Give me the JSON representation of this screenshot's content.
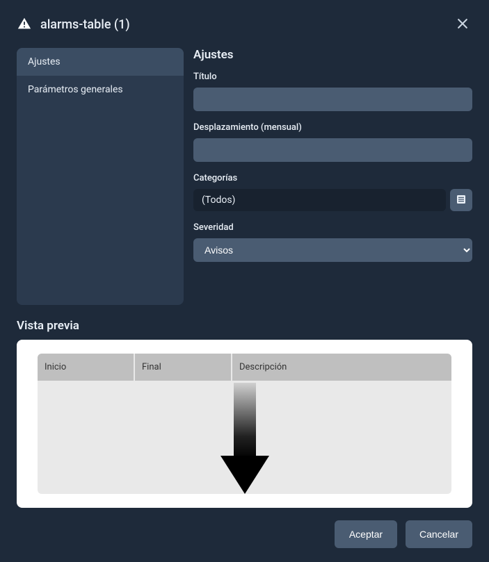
{
  "header": {
    "title": "alarms-table (1)"
  },
  "sidebar": {
    "items": [
      {
        "label": "Ajustes",
        "active": true
      },
      {
        "label": "Parámetros generales",
        "active": false
      }
    ]
  },
  "panel": {
    "title": "Ajustes",
    "titulo_label": "Título",
    "titulo_value": "",
    "desplazamiento_label": "Desplazamiento (mensual)",
    "desplazamiento_value": "",
    "categorias_label": "Categorías",
    "categorias_value": "(Todos)",
    "severidad_label": "Severidad",
    "severidad_value": "Avisos"
  },
  "preview": {
    "title": "Vista previa",
    "columns": {
      "inicio": "Inicio",
      "final": "Final",
      "descripcion": "Descripción"
    }
  },
  "footer": {
    "accept": "Aceptar",
    "cancel": "Cancelar"
  }
}
